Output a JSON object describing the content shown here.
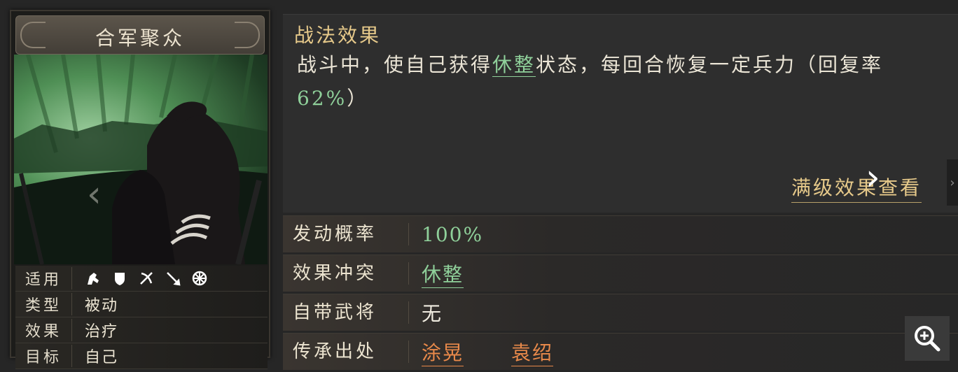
{
  "card": {
    "title": "合军聚众",
    "attributes": [
      {
        "key": "适用",
        "icons": [
          "cavalry-icon",
          "shield-icon",
          "bow-icon",
          "spear-icon",
          "siege-icon"
        ]
      },
      {
        "key": "类型",
        "value": "被动"
      },
      {
        "key": "效果",
        "value": "治疗"
      },
      {
        "key": "目标",
        "value": "自己"
      }
    ]
  },
  "effect": {
    "title": "战法效果",
    "text_a": "战斗中，使自己获得",
    "keyword": "休整",
    "text_b": "状态，每回合恢复一定兵力（回复率",
    "rate": "62%",
    "text_c": "）",
    "full_link": "满级效果查看"
  },
  "rows": {
    "probability": {
      "label": "发动概率",
      "value": "100%"
    },
    "conflict": {
      "label": "效果冲突",
      "value": "休整"
    },
    "own_general": {
      "label": "自带武将",
      "value": "无"
    },
    "inherit": {
      "label": "传承出处",
      "values": [
        "涂晃",
        "袁绍"
      ]
    }
  },
  "colors": {
    "gold": "#e6c98a",
    "green": "#8fd09a",
    "orange": "#e8894a"
  }
}
